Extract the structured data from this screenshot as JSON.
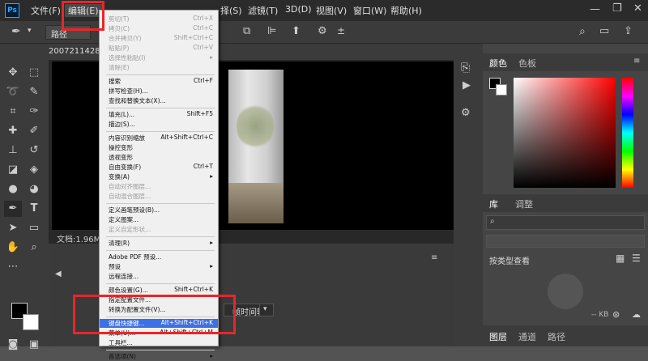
{
  "menubar": {
    "items": [
      "文件(F)",
      "编辑(E)",
      "择(S)",
      "滤镜(T)",
      "3D(D)",
      "视图(V)",
      "窗口(W)",
      "帮助(H)"
    ],
    "logo": "Ps"
  },
  "optbar": {
    "mode_label": "路径"
  },
  "document": {
    "tab_fragment": "200721142817",
    "status": "文档:1.96M"
  },
  "timeline": {
    "frame_label": "帧时间轴"
  },
  "panels": {
    "color_tabs": [
      "颜色",
      "色板"
    ],
    "library_tabs": [
      "库",
      "调整"
    ],
    "library_view": "按类型查看",
    "library_size": "-- KB",
    "bottom_tabs": [
      "图层",
      "通道",
      "路径"
    ]
  },
  "edit_menu": {
    "groups": [
      [
        {
          "label": "剪切(T)",
          "shortcut": "Ctrl+X",
          "disabled": true
        },
        {
          "label": "拷贝(C)",
          "shortcut": "Ctrl+C",
          "disabled": true
        },
        {
          "label": "合并拷贝(Y)",
          "shortcut": "Shift+Ctrl+C",
          "disabled": true
        },
        {
          "label": "粘贴(P)",
          "shortcut": "Ctrl+V",
          "disabled": true
        },
        {
          "label": "选择性粘贴(I)",
          "shortcut": "",
          "disabled": true,
          "submenu": true
        },
        {
          "label": "清除(E)",
          "shortcut": "",
          "disabled": true
        }
      ],
      [
        {
          "label": "搜索",
          "shortcut": "Ctrl+F"
        },
        {
          "label": "拼写检查(H)...",
          "shortcut": ""
        },
        {
          "label": "查找和替换文本(X)...",
          "shortcut": ""
        }
      ],
      [
        {
          "label": "填充(L)...",
          "shortcut": "Shift+F5"
        },
        {
          "label": "描边(S)...",
          "shortcut": ""
        }
      ],
      [
        {
          "label": "内容识别缩放",
          "shortcut": "Alt+Shift+Ctrl+C"
        },
        {
          "label": "操控变形",
          "shortcut": ""
        },
        {
          "label": "透视变形",
          "shortcut": ""
        },
        {
          "label": "自由变换(F)",
          "shortcut": "Ctrl+T"
        },
        {
          "label": "变换(A)",
          "shortcut": "",
          "submenu": true
        },
        {
          "label": "自动对齐图层...",
          "shortcut": "",
          "disabled": true
        },
        {
          "label": "自动混合图层...",
          "shortcut": "",
          "disabled": true
        }
      ],
      [
        {
          "label": "定义画笔预设(B)...",
          "shortcut": ""
        },
        {
          "label": "定义图案...",
          "shortcut": ""
        },
        {
          "label": "定义自定形状...",
          "shortcut": "",
          "disabled": true
        }
      ],
      [
        {
          "label": "清理(R)",
          "shortcut": "",
          "submenu": true
        }
      ],
      [
        {
          "label": "Adobe PDF 预设...",
          "shortcut": ""
        },
        {
          "label": "预设",
          "shortcut": "",
          "submenu": true
        },
        {
          "label": "远程连接...",
          "shortcut": ""
        }
      ],
      [
        {
          "label": "颜色设置(G)...",
          "shortcut": "Shift+Ctrl+K"
        },
        {
          "label": "指定配置文件...",
          "shortcut": ""
        },
        {
          "label": "转换为配置文件(V)...",
          "shortcut": ""
        }
      ],
      [
        {
          "label": "键盘快捷键...",
          "shortcut": "Alt+Shift+Ctrl+K",
          "highlighted": true
        },
        {
          "label": "菜单(U)...",
          "shortcut": "Alt+Shift+Ctrl+M"
        },
        {
          "label": "工具栏...",
          "shortcut": ""
        }
      ],
      [
        {
          "label": "首选项(N)",
          "shortcut": "",
          "submenu": true
        }
      ]
    ]
  }
}
